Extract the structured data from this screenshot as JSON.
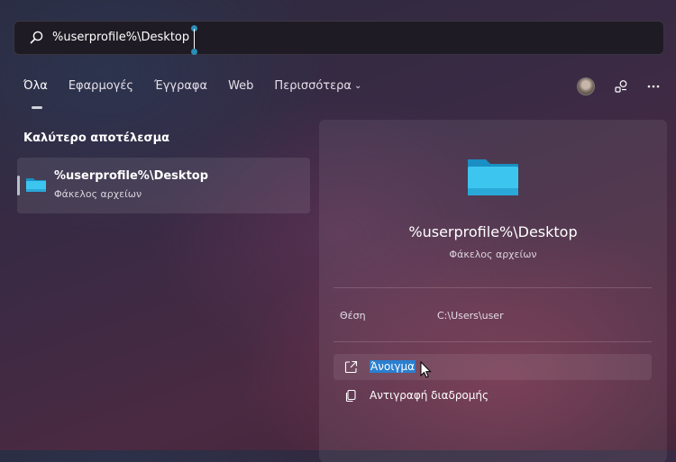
{
  "search": {
    "query": "%userprofile%\\Desktop",
    "icon": "search-icon"
  },
  "tabs": [
    {
      "label": "Όλα",
      "active": true
    },
    {
      "label": "Εφαρμογές",
      "active": false
    },
    {
      "label": "Έγγραφα",
      "active": false
    },
    {
      "label": "Web",
      "active": false
    },
    {
      "label": "Περισσότερα",
      "active": false,
      "dropdown": true
    }
  ],
  "toolbar": {
    "avatar": "user-avatar",
    "share_icon": "rewards-share-icon",
    "more_icon": "more-options-icon"
  },
  "best_match": {
    "heading": "Καλύτερο αποτέλεσμα",
    "name": "%userprofile%\\Desktop",
    "type": "Φάκελος αρχείων"
  },
  "detail": {
    "title": "%userprofile%\\Desktop",
    "subtitle": "Φάκελος αρχείων",
    "location_label": "Θέση",
    "location_value": "C:\\Users\\user",
    "actions": [
      {
        "label": "Άνοιγμα",
        "icon": "open-external-icon"
      },
      {
        "label": "Αντιγραφή διαδρομής",
        "icon": "copy-icon"
      }
    ]
  },
  "colors": {
    "accent": "#2b7fd0",
    "folder_light": "#3cc6ef",
    "folder_dark": "#1a8fc4"
  }
}
